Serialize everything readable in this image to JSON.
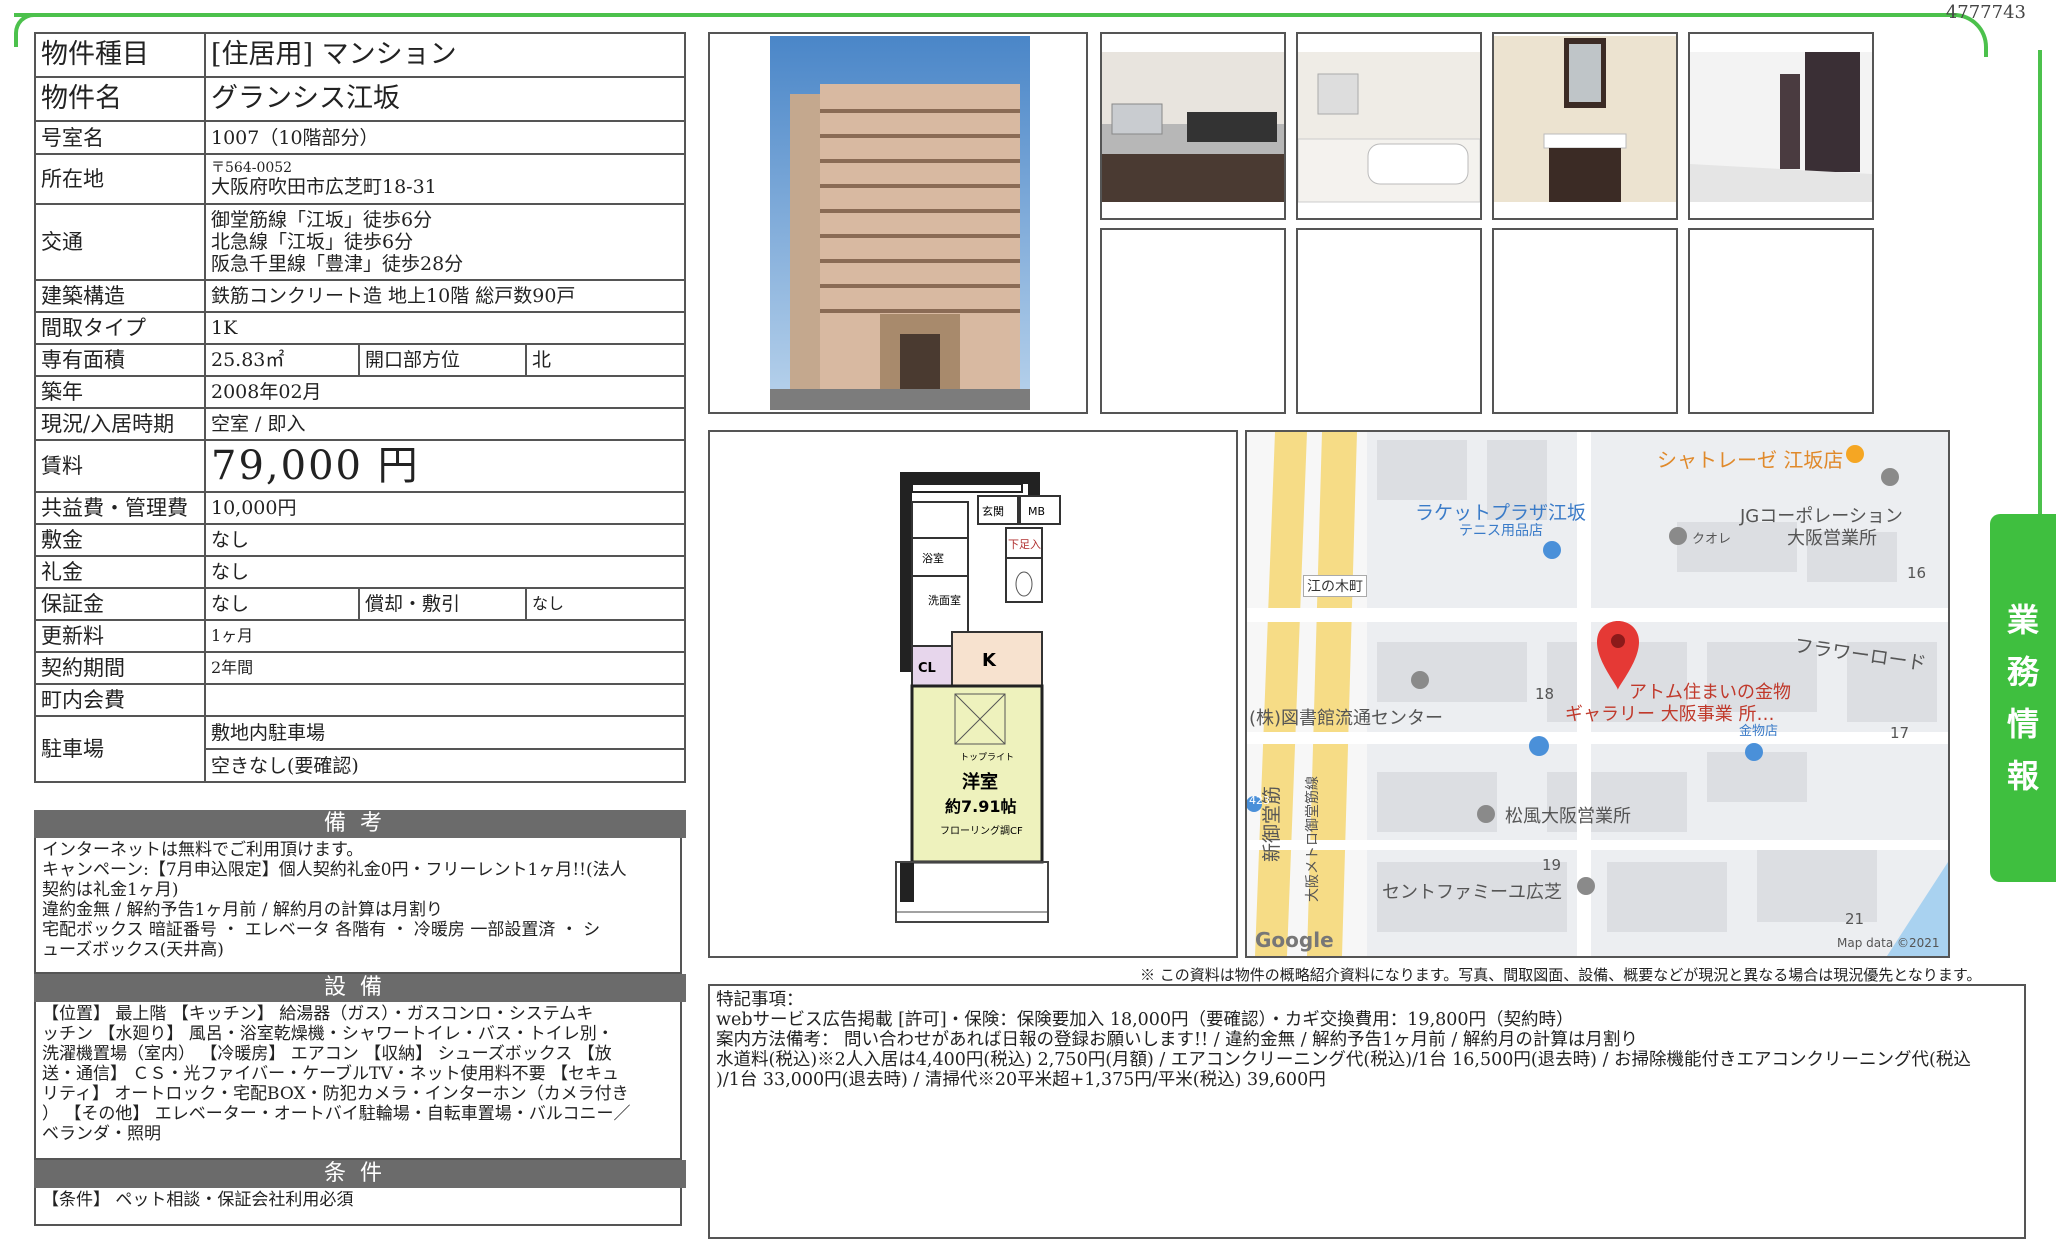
{
  "listing_id": "4777743",
  "side_tab": [
    "業",
    "務",
    "情",
    "報"
  ],
  "rows": {
    "type": {
      "label": "物件種目",
      "value": "[住居用]  マンション"
    },
    "name": {
      "label": "物件名",
      "value": "グランシス江坂"
    },
    "room": {
      "label": "号室名",
      "value": "1007（10階部分）"
    },
    "address": {
      "label": "所在地",
      "postal": "〒564-0052",
      "value": "大阪府吹田市広芝町18-31"
    },
    "access": {
      "label": "交通",
      "lines": [
        "御堂筋線「江坂」徒歩6分",
        "北急線「江坂」徒歩6分",
        "阪急千里線「豊津」徒歩28分"
      ]
    },
    "structure": {
      "label": "建築構造",
      "value": "鉄筋コンクリート造 地上10階 総戸数90戸"
    },
    "layout": {
      "label": "間取タイプ",
      "value": "1K"
    },
    "area": {
      "label": "専有面積",
      "value": "25.83㎡",
      "label2": "開口部方位",
      "value2": "北"
    },
    "built": {
      "label": "築年",
      "value": "2008年02月"
    },
    "status": {
      "label": "現況/入居時期",
      "value": "空室 / 即入"
    },
    "rent": {
      "label": "賃料",
      "value": "79,000 円"
    },
    "fee": {
      "label": "共益費・管理費",
      "value": "10,000円"
    },
    "deposit": {
      "label": "敷金",
      "value": "なし"
    },
    "key_money": {
      "label": "礼金",
      "value": "なし"
    },
    "guarantee": {
      "label": "保証金",
      "value": "なし",
      "label2": "償却・敷引",
      "value2": "なし"
    },
    "renewal": {
      "label": "更新料",
      "value": "1ヶ月"
    },
    "contract": {
      "label": "契約期間",
      "value": "2年間"
    },
    "town_fee": {
      "label": "町内会費",
      "value": ""
    },
    "parking": {
      "label": "駐車場",
      "value": "敷地内駐車場",
      "value2": "空きなし(要確認)"
    }
  },
  "biko": {
    "title": "備考",
    "lines": [
      "インターネットは無料でご利用頂けます。",
      "キャンペーン:【7月申込限定】個人契約礼金0円・フリーレント1ヶ月!!(法人",
      "契約は礼金1ヶ月)",
      "違約金無 / 解約予告1ヶ月前 / 解約月の計算は月割り",
      "宅配ボックス 暗証番号 ・ エレベータ 各階有 ・ 冷暖房 一部設置済 ・ シ",
      "ューズボックス(天井高)"
    ]
  },
  "setsubi": {
    "title": "設備",
    "lines": [
      "【位置】 最上階 【キッチン】 給湯器（ガス）・ガスコンロ・システムキ",
      "ッチン 【水廻り】 風呂・浴室乾燥機・シャワートイレ・バス・トイレ別・",
      "洗濯機置場（室内） 【冷暖房】 エアコン 【収納】 シューズボックス 【放",
      "送・通信】 ＣＳ・光ファイバー・ケーブルTV・ネット使用料不要 【セキュ",
      "リティ】 オートロック・宅配BOX・防犯カメラ・インターホン（カメラ付き",
      "） 【その他】 エレベーター・オートバイ駐輪場・自転車置場・バルコニー／",
      "ベランダ・照明"
    ]
  },
  "joken": {
    "title": "条件",
    "lines": [
      "【条件】 ペット相談・保証会社利用必須"
    ]
  },
  "floorplan": {
    "labels": {
      "entrance": "玄関",
      "mb": "MB",
      "bath": "浴室",
      "shoes": "下足入",
      "wash": "洗面室",
      "kitchen": "K",
      "closet": "CL",
      "toplight": "トップライト",
      "room": "洋室",
      "size": "約7.91帖",
      "floor": "フローリング調CF"
    }
  },
  "map": {
    "labels": [
      "シャトレーゼ 江坂店",
      "ラケットプラザ江坂",
      "テニス用品店",
      "JGコーポレーション",
      "大阪営業所",
      "クオレ",
      "江の木町",
      "フラワーロード",
      "16",
      "18",
      "17",
      "アトム住まいの金物",
      "ギャラリー 大阪事業 所…",
      "金物店",
      "(株)図書館流通センター",
      "松風大阪営業所",
      "19",
      "セントファミーユ広芝",
      "21",
      "新御堂筋",
      "大阪メトロ御堂筋線",
      "423",
      "Google",
      "Map data ©2021"
    ]
  },
  "disclaimer": "※ この資料は物件の概略紹介資料になります。写真、間取図面、設備、概要などが現況と異なる場合は現況優先となります。",
  "remarks": {
    "title": "特記事項：",
    "lines": [
      "webサービス広告掲載 [許可]・保険：保険要加入 18,000円（要確認）・カギ交換費用：19,800円（契約時）",
      "案内方法備考： 問い合わせがあれば日報の登録お願いします!! / 違約金無 / 解約予告1ヶ月前 / 解約月の計算は月割り",
      "水道料(税込)※2人入居は4,400円(税込) 2,750円(月額) / エアコンクリーニング代(税込)/1台 16,500円(退去時) / お掃除機能付きエアコンクリーニング代(税込",
      ")/1台 33,000円(退去時) / 清掃代※20平米超+1,375円/平米(税込) 39,600円"
    ]
  }
}
